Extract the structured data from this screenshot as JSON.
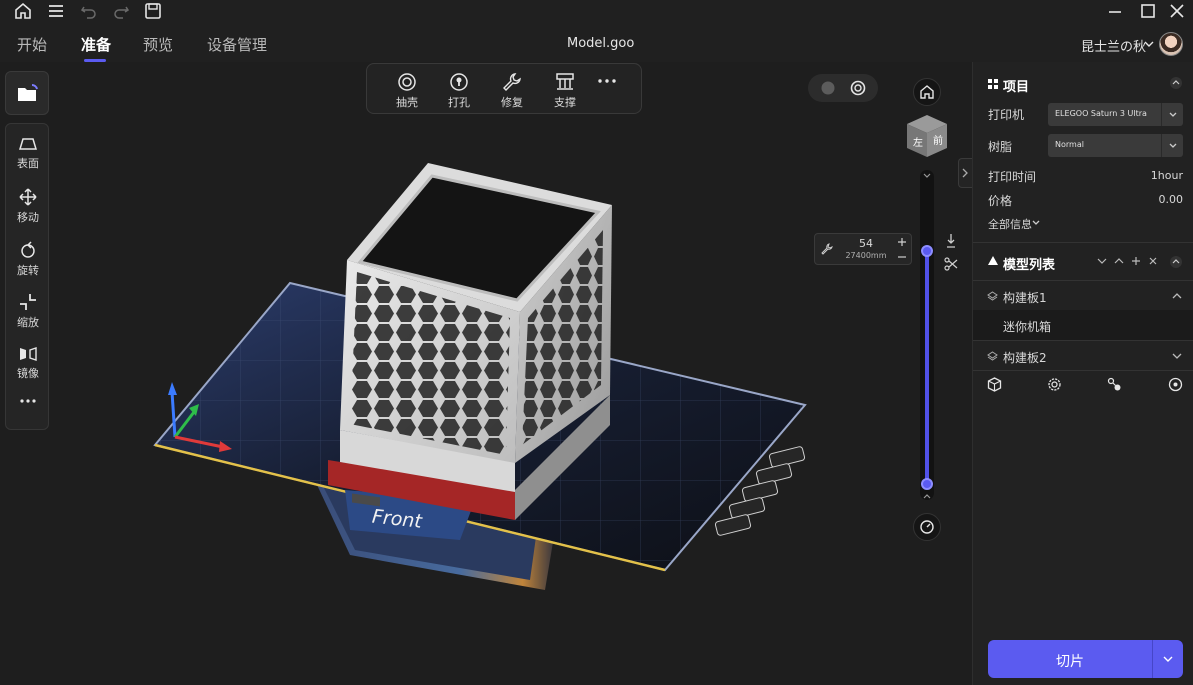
{
  "titlebar": {
    "icons": [
      "home-icon",
      "menu-icon",
      "undo-icon",
      "redo-icon",
      "save-icon"
    ],
    "tabs": [
      {
        "label": "开始"
      },
      {
        "label": "准备",
        "active": true
      },
      {
        "label": "预览"
      },
      {
        "label": "设备管理"
      }
    ],
    "filename": "Model.goo",
    "user": "昆士兰の秋",
    "window_controls": [
      "minimize-icon",
      "maximize-icon",
      "close-icon"
    ]
  },
  "left_toolbar": {
    "open_icon": "open-folder-icon",
    "tools": [
      {
        "label": "表面",
        "icon": "surface-icon"
      },
      {
        "label": "移动",
        "icon": "move-icon"
      },
      {
        "label": "旋转",
        "icon": "rotate-icon"
      },
      {
        "label": "缩放",
        "icon": "scale-icon"
      },
      {
        "label": "镜像",
        "icon": "mirror-icon"
      }
    ],
    "more_icon": "more-icon"
  },
  "top_toolbar": {
    "tools": [
      {
        "label": "抽壳",
        "icon": "hollow-icon"
      },
      {
        "label": "打孔",
        "icon": "punch-hole-icon"
      },
      {
        "label": "修复",
        "icon": "repair-icon"
      },
      {
        "label": "支撑",
        "icon": "support-icon"
      }
    ],
    "more_icon": "more-icon"
  },
  "viewport": {
    "front_label": "Front",
    "view_cube": {
      "left": "左",
      "front": "前"
    },
    "layer": {
      "number": "54",
      "height": "27400mm"
    },
    "layer_slider_level": 1.0
  },
  "panel": {
    "project": {
      "title": "项目",
      "printer_label": "打印机",
      "printer_value": "ELEGOO Saturn 3 Ultra",
      "resin_label": "树脂",
      "resin_value": "Normal",
      "print_time_label": "打印时间",
      "print_time_value": "1hour",
      "price_label": "价格",
      "price_value": "0.00",
      "all_info": "全部信息"
    },
    "model_list": {
      "title": "模型列表",
      "plates": [
        {
          "label": "构建板1",
          "expanded": true,
          "items": [
            "迷你机箱"
          ]
        },
        {
          "label": "构建板2",
          "expanded": false
        }
      ],
      "actions": [
        "model-icon",
        "settings-icon",
        "group-icon",
        "target-icon"
      ]
    },
    "slice_button": "切片"
  },
  "colors": {
    "accent": "#5b5bf0",
    "background": "#1c1c1c",
    "panel": "#222222"
  }
}
